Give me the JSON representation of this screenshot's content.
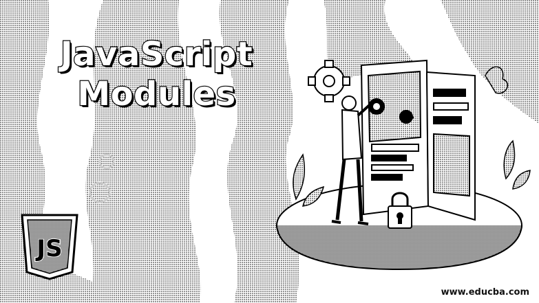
{
  "banner": {
    "title_line1": "JavaScript",
    "title_line2": "Modules",
    "website": "www.educba.com"
  },
  "badge": {
    "icon": "javascript-shield-icon",
    "text": "JS"
  },
  "illustration": {
    "icon": "developer-at-screens-illustration",
    "elements": [
      "gear-icon",
      "padlock-icon",
      "code-window",
      "plant-leaves"
    ]
  },
  "colors": {
    "ink": "#000000",
    "paper": "#ffffff"
  }
}
